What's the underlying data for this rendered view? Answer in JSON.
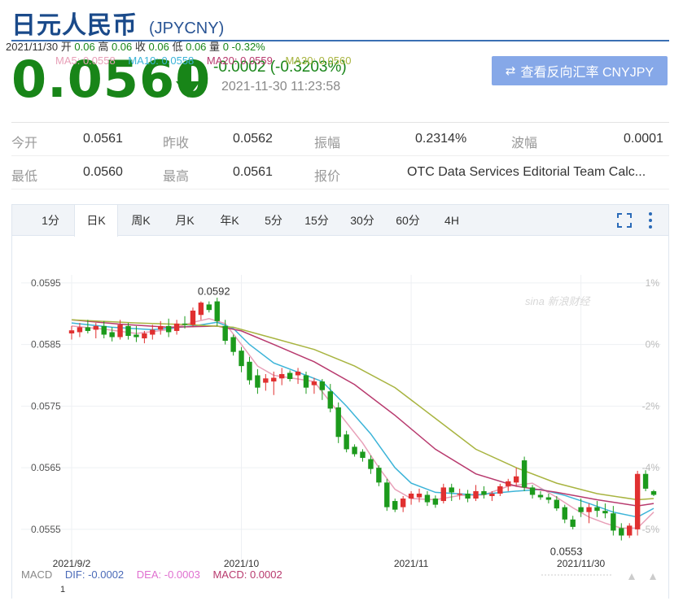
{
  "header": {
    "name": "日元人民币",
    "code": "(JPYCNY)"
  },
  "quote": {
    "price": "0.0560",
    "change": "-0.0002 (-0.3203%)",
    "time": "2021-11-30 11:23:58",
    "direction": "down",
    "reverse_button": "查看反向汇率 CNYJPY"
  },
  "stats": {
    "row1": [
      {
        "label": "今开",
        "value": "0.0561"
      },
      {
        "label": "昨收",
        "value": "0.0562"
      },
      {
        "label": "振幅",
        "value": "0.2314%"
      },
      {
        "label": "波幅",
        "value": "0.0001"
      }
    ],
    "row2": [
      {
        "label": "最低",
        "value": "0.0560"
      },
      {
        "label": "最高",
        "value": "0.0561"
      },
      {
        "label": "报价",
        "value": "OTC Data Services Editorial Team Calc..."
      }
    ]
  },
  "tabs": [
    "1分",
    "日K",
    "周K",
    "月K",
    "年K",
    "5分",
    "15分",
    "30分",
    "60分",
    "4H"
  ],
  "active_tab": "日K",
  "ohlc_bar": {
    "date": "2021/11/30",
    "open_label": "开",
    "open": "0.06",
    "high_label": "高",
    "high": "0.06",
    "close_label": "收",
    "close": "0.06",
    "low_label": "低",
    "low": "0.06",
    "vol_label": "量",
    "vol": "0",
    "pct": "-0.32%"
  },
  "ma_legend": {
    "ma5": "MA5: 0.0558",
    "ma10": "MA10: 0.0558",
    "ma20": "MA20: 0.0559",
    "ma30": "MA30: 0.0560"
  },
  "macd_legend": {
    "title": "MACD",
    "dif": "DIF: -0.0002",
    "dea": "DEA: -0.0003",
    "macd": "MACD: 0.0002",
    "scale_top": "1"
  },
  "colors": {
    "up": "#e03030",
    "down": "#1c9a1c",
    "ma5": "#e8a0b8",
    "ma10": "#3cb4d8",
    "ma20": "#b83a6e",
    "ma30": "#a8b440",
    "brand_blue": "#1a4a8a",
    "button": "#86a8e8"
  },
  "watermark": "sina 新浪财经",
  "chart_data": {
    "type": "candlestick",
    "ylim": [
      0.05505,
      0.05963
    ],
    "y_ticks": [
      "0.0595",
      "0.0585",
      "0.0575",
      "0.0565",
      "0.0555"
    ],
    "y_tick_values": [
      0.0595,
      0.0585,
      0.0575,
      0.0565,
      0.0555
    ],
    "right_ticks": [
      "1%",
      "0%",
      "-2%",
      "-4%",
      "-5%"
    ],
    "right_tick_values": [
      0.0595,
      0.0585,
      0.0575,
      0.0565,
      0.0555
    ],
    "x_labels": [
      {
        "label": "2021/9/2",
        "index": 0
      },
      {
        "label": "2021/10",
        "index": 21
      },
      {
        "label": "2021/11",
        "index": 42
      },
      {
        "label": "2021/11/30",
        "index": 63
      }
    ],
    "annotations": [
      {
        "text": "0.0592",
        "index": 17,
        "value": 0.0592
      },
      {
        "text": "0.0553",
        "index": 61,
        "value": 0.05532
      }
    ],
    "candles": [
      {
        "o": 0.05868,
        "h": 0.0588,
        "l": 0.05858,
        "c": 0.05873
      },
      {
        "o": 0.0587,
        "h": 0.05885,
        "l": 0.05862,
        "c": 0.05878
      },
      {
        "o": 0.05878,
        "h": 0.0589,
        "l": 0.05868,
        "c": 0.05872
      },
      {
        "o": 0.05874,
        "h": 0.05885,
        "l": 0.0586,
        "c": 0.0588
      },
      {
        "o": 0.0588,
        "h": 0.05888,
        "l": 0.0586,
        "c": 0.05866
      },
      {
        "o": 0.0587,
        "h": 0.05878,
        "l": 0.05855,
        "c": 0.05862
      },
      {
        "o": 0.05862,
        "h": 0.0589,
        "l": 0.05858,
        "c": 0.05882
      },
      {
        "o": 0.0588,
        "h": 0.05885,
        "l": 0.05858,
        "c": 0.05864
      },
      {
        "o": 0.05866,
        "h": 0.0588,
        "l": 0.05854,
        "c": 0.05862
      },
      {
        "o": 0.0586,
        "h": 0.05872,
        "l": 0.05852,
        "c": 0.05868
      },
      {
        "o": 0.05866,
        "h": 0.05882,
        "l": 0.05858,
        "c": 0.05874
      },
      {
        "o": 0.05874,
        "h": 0.05888,
        "l": 0.05866,
        "c": 0.0588
      },
      {
        "o": 0.0588,
        "h": 0.05892,
        "l": 0.05862,
        "c": 0.0587
      },
      {
        "o": 0.05872,
        "h": 0.0589,
        "l": 0.05866,
        "c": 0.05884
      },
      {
        "o": 0.05884,
        "h": 0.05896,
        "l": 0.05876,
        "c": 0.05882
      },
      {
        "o": 0.05882,
        "h": 0.0591,
        "l": 0.05878,
        "c": 0.05905
      },
      {
        "o": 0.05898,
        "h": 0.0592,
        "l": 0.0589,
        "c": 0.05918
      },
      {
        "o": 0.05915,
        "h": 0.0592,
        "l": 0.05902,
        "c": 0.05906
      },
      {
        "o": 0.0592,
        "h": 0.05926,
        "l": 0.0588,
        "c": 0.05888
      },
      {
        "o": 0.0588,
        "h": 0.0589,
        "l": 0.0585,
        "c": 0.05856
      },
      {
        "o": 0.05862,
        "h": 0.05866,
        "l": 0.05832,
        "c": 0.05838
      },
      {
        "o": 0.0584,
        "h": 0.05846,
        "l": 0.05805,
        "c": 0.05815
      },
      {
        "o": 0.05822,
        "h": 0.0583,
        "l": 0.05785,
        "c": 0.05792
      },
      {
        "o": 0.058,
        "h": 0.0581,
        "l": 0.0577,
        "c": 0.0578
      },
      {
        "o": 0.05788,
        "h": 0.05802,
        "l": 0.05775,
        "c": 0.05795
      },
      {
        "o": 0.0579,
        "h": 0.05806,
        "l": 0.05768,
        "c": 0.05796
      },
      {
        "o": 0.05795,
        "h": 0.05812,
        "l": 0.05784,
        "c": 0.05802
      },
      {
        "o": 0.05804,
        "h": 0.05808,
        "l": 0.0579,
        "c": 0.05794
      },
      {
        "o": 0.058,
        "h": 0.05812,
        "l": 0.05786,
        "c": 0.05806
      },
      {
        "o": 0.058,
        "h": 0.05806,
        "l": 0.0577,
        "c": 0.0578
      },
      {
        "o": 0.05784,
        "h": 0.05796,
        "l": 0.0577,
        "c": 0.0579
      },
      {
        "o": 0.0579,
        "h": 0.05794,
        "l": 0.0576,
        "c": 0.05776
      },
      {
        "o": 0.05774,
        "h": 0.05786,
        "l": 0.0574,
        "c": 0.05746
      },
      {
        "o": 0.05748,
        "h": 0.05756,
        "l": 0.0569,
        "c": 0.057
      },
      {
        "o": 0.05704,
        "h": 0.0571,
        "l": 0.05675,
        "c": 0.0568
      },
      {
        "o": 0.05684,
        "h": 0.05688,
        "l": 0.05668,
        "c": 0.05672
      },
      {
        "o": 0.05676,
        "h": 0.0568,
        "l": 0.0566,
        "c": 0.05666
      },
      {
        "o": 0.05664,
        "h": 0.0567,
        "l": 0.0564,
        "c": 0.05648
      },
      {
        "o": 0.0565,
        "h": 0.05654,
        "l": 0.0562,
        "c": 0.05626
      },
      {
        "o": 0.05626,
        "h": 0.05632,
        "l": 0.0558,
        "c": 0.05586
      },
      {
        "o": 0.05596,
        "h": 0.056,
        "l": 0.05578,
        "c": 0.05582
      },
      {
        "o": 0.05586,
        "h": 0.05604,
        "l": 0.05578,
        "c": 0.056
      },
      {
        "o": 0.056,
        "h": 0.05612,
        "l": 0.0559,
        "c": 0.05608
      },
      {
        "o": 0.05602,
        "h": 0.05616,
        "l": 0.05594,
        "c": 0.05608
      },
      {
        "o": 0.05606,
        "h": 0.05612,
        "l": 0.05588,
        "c": 0.05594
      },
      {
        "o": 0.056,
        "h": 0.05605,
        "l": 0.05585,
        "c": 0.0559
      },
      {
        "o": 0.05596,
        "h": 0.05624,
        "l": 0.05592,
        "c": 0.05618
      },
      {
        "o": 0.05618,
        "h": 0.05624,
        "l": 0.05596,
        "c": 0.0561
      },
      {
        "o": 0.05606,
        "h": 0.05616,
        "l": 0.05598,
        "c": 0.05608
      },
      {
        "o": 0.05608,
        "h": 0.05614,
        "l": 0.05594,
        "c": 0.056
      },
      {
        "o": 0.056,
        "h": 0.05622,
        "l": 0.05596,
        "c": 0.05612
      },
      {
        "o": 0.05612,
        "h": 0.0562,
        "l": 0.056,
        "c": 0.05606
      },
      {
        "o": 0.05604,
        "h": 0.05612,
        "l": 0.05596,
        "c": 0.05608
      },
      {
        "o": 0.05608,
        "h": 0.05624,
        "l": 0.05604,
        "c": 0.0562
      },
      {
        "o": 0.0562,
        "h": 0.05632,
        "l": 0.05612,
        "c": 0.05628
      },
      {
        "o": 0.05626,
        "h": 0.0565,
        "l": 0.0562,
        "c": 0.05636
      },
      {
        "o": 0.05662,
        "h": 0.05668,
        "l": 0.05612,
        "c": 0.05618
      },
      {
        "o": 0.05618,
        "h": 0.05622,
        "l": 0.056,
        "c": 0.05606
      },
      {
        "o": 0.05606,
        "h": 0.05612,
        "l": 0.05598,
        "c": 0.05602
      },
      {
        "o": 0.05602,
        "h": 0.05608,
        "l": 0.05592,
        "c": 0.05598
      },
      {
        "o": 0.05598,
        "h": 0.05604,
        "l": 0.0558,
        "c": 0.05584
      },
      {
        "o": 0.05586,
        "h": 0.0559,
        "l": 0.0556,
        "c": 0.05566
      },
      {
        "o": 0.05566,
        "h": 0.05572,
        "l": 0.0555,
        "c": 0.05554
      },
      {
        "o": 0.05586,
        "h": 0.056,
        "l": 0.0557,
        "c": 0.05578
      },
      {
        "o": 0.05578,
        "h": 0.05592,
        "l": 0.0556,
        "c": 0.05586
      },
      {
        "o": 0.05586,
        "h": 0.05596,
        "l": 0.0557,
        "c": 0.0558
      },
      {
        "o": 0.0558,
        "h": 0.05592,
        "l": 0.05568,
        "c": 0.05576
      },
      {
        "o": 0.05576,
        "h": 0.05588,
        "l": 0.0554,
        "c": 0.05548
      },
      {
        "o": 0.05552,
        "h": 0.0556,
        "l": 0.05532,
        "c": 0.0554
      },
      {
        "o": 0.0554,
        "h": 0.0556,
        "l": 0.05536,
        "c": 0.05556
      },
      {
        "o": 0.0555,
        "h": 0.05645,
        "l": 0.0554,
        "c": 0.0564
      },
      {
        "o": 0.0564,
        "h": 0.05646,
        "l": 0.05612,
        "c": 0.05616
      },
      {
        "o": 0.05612,
        "h": 0.05614,
        "l": 0.05604,
        "c": 0.05606
      }
    ],
    "ma_series": [
      {
        "name": "MA5",
        "color": "#e8a0b8",
        "points": [
          [
            0,
            0.0588
          ],
          [
            4,
            0.05875
          ],
          [
            8,
            0.05868
          ],
          [
            12,
            0.05874
          ],
          [
            15,
            0.05886
          ],
          [
            17,
            0.05892
          ],
          [
            19,
            0.05884
          ],
          [
            21,
            0.0585
          ],
          [
            23,
            0.05815
          ],
          [
            25,
            0.058
          ],
          [
            27,
            0.05796
          ],
          [
            30,
            0.0579
          ],
          [
            33,
            0.0574
          ],
          [
            36,
            0.0569
          ],
          [
            38,
            0.0565
          ],
          [
            40,
            0.05615
          ],
          [
            42,
            0.056
          ],
          [
            45,
            0.05598
          ],
          [
            48,
            0.05605
          ],
          [
            51,
            0.05606
          ],
          [
            54,
            0.0562
          ],
          [
            57,
            0.05625
          ],
          [
            60,
            0.05602
          ],
          [
            62,
            0.05585
          ],
          [
            64,
            0.0557
          ],
          [
            66,
            0.0556
          ],
          [
            68,
            0.05552
          ],
          [
            70,
            0.05552
          ],
          [
            72,
            0.05578
          ]
        ]
      },
      {
        "name": "MA10",
        "color": "#3cb4d8",
        "points": [
          [
            0,
            0.05885
          ],
          [
            5,
            0.05878
          ],
          [
            10,
            0.05874
          ],
          [
            15,
            0.0588
          ],
          [
            18,
            0.05886
          ],
          [
            20,
            0.05876
          ],
          [
            22,
            0.0585
          ],
          [
            25,
            0.0582
          ],
          [
            28,
            0.05805
          ],
          [
            31,
            0.0579
          ],
          [
            34,
            0.0575
          ],
          [
            37,
            0.05705
          ],
          [
            40,
            0.0565
          ],
          [
            42,
            0.05625
          ],
          [
            45,
            0.0561
          ],
          [
            50,
            0.05606
          ],
          [
            55,
            0.05612
          ],
          [
            58,
            0.05615
          ],
          [
            61,
            0.05605
          ],
          [
            64,
            0.05592
          ],
          [
            67,
            0.05578
          ],
          [
            70,
            0.0557
          ],
          [
            72,
            0.05584
          ]
        ]
      },
      {
        "name": "MA20",
        "color": "#b83a6e",
        "points": [
          [
            0,
            0.0589
          ],
          [
            6,
            0.05883
          ],
          [
            12,
            0.05878
          ],
          [
            18,
            0.0588
          ],
          [
            21,
            0.05872
          ],
          [
            25,
            0.0585
          ],
          [
            30,
            0.05822
          ],
          [
            35,
            0.05785
          ],
          [
            40,
            0.05735
          ],
          [
            45,
            0.0568
          ],
          [
            50,
            0.0564
          ],
          [
            55,
            0.0562
          ],
          [
            60,
            0.0561
          ],
          [
            65,
            0.05598
          ],
          [
            70,
            0.05588
          ],
          [
            72,
            0.05592
          ]
        ]
      },
      {
        "name": "MA30",
        "color": "#a8b440",
        "points": [
          [
            0,
            0.0589
          ],
          [
            8,
            0.05885
          ],
          [
            15,
            0.05882
          ],
          [
            20,
            0.05878
          ],
          [
            25,
            0.0586
          ],
          [
            30,
            0.05842
          ],
          [
            35,
            0.05815
          ],
          [
            40,
            0.0578
          ],
          [
            45,
            0.0573
          ],
          [
            50,
            0.0568
          ],
          [
            55,
            0.0565
          ],
          [
            60,
            0.05625
          ],
          [
            65,
            0.05608
          ],
          [
            70,
            0.05598
          ],
          [
            72,
            0.056
          ]
        ]
      }
    ]
  }
}
